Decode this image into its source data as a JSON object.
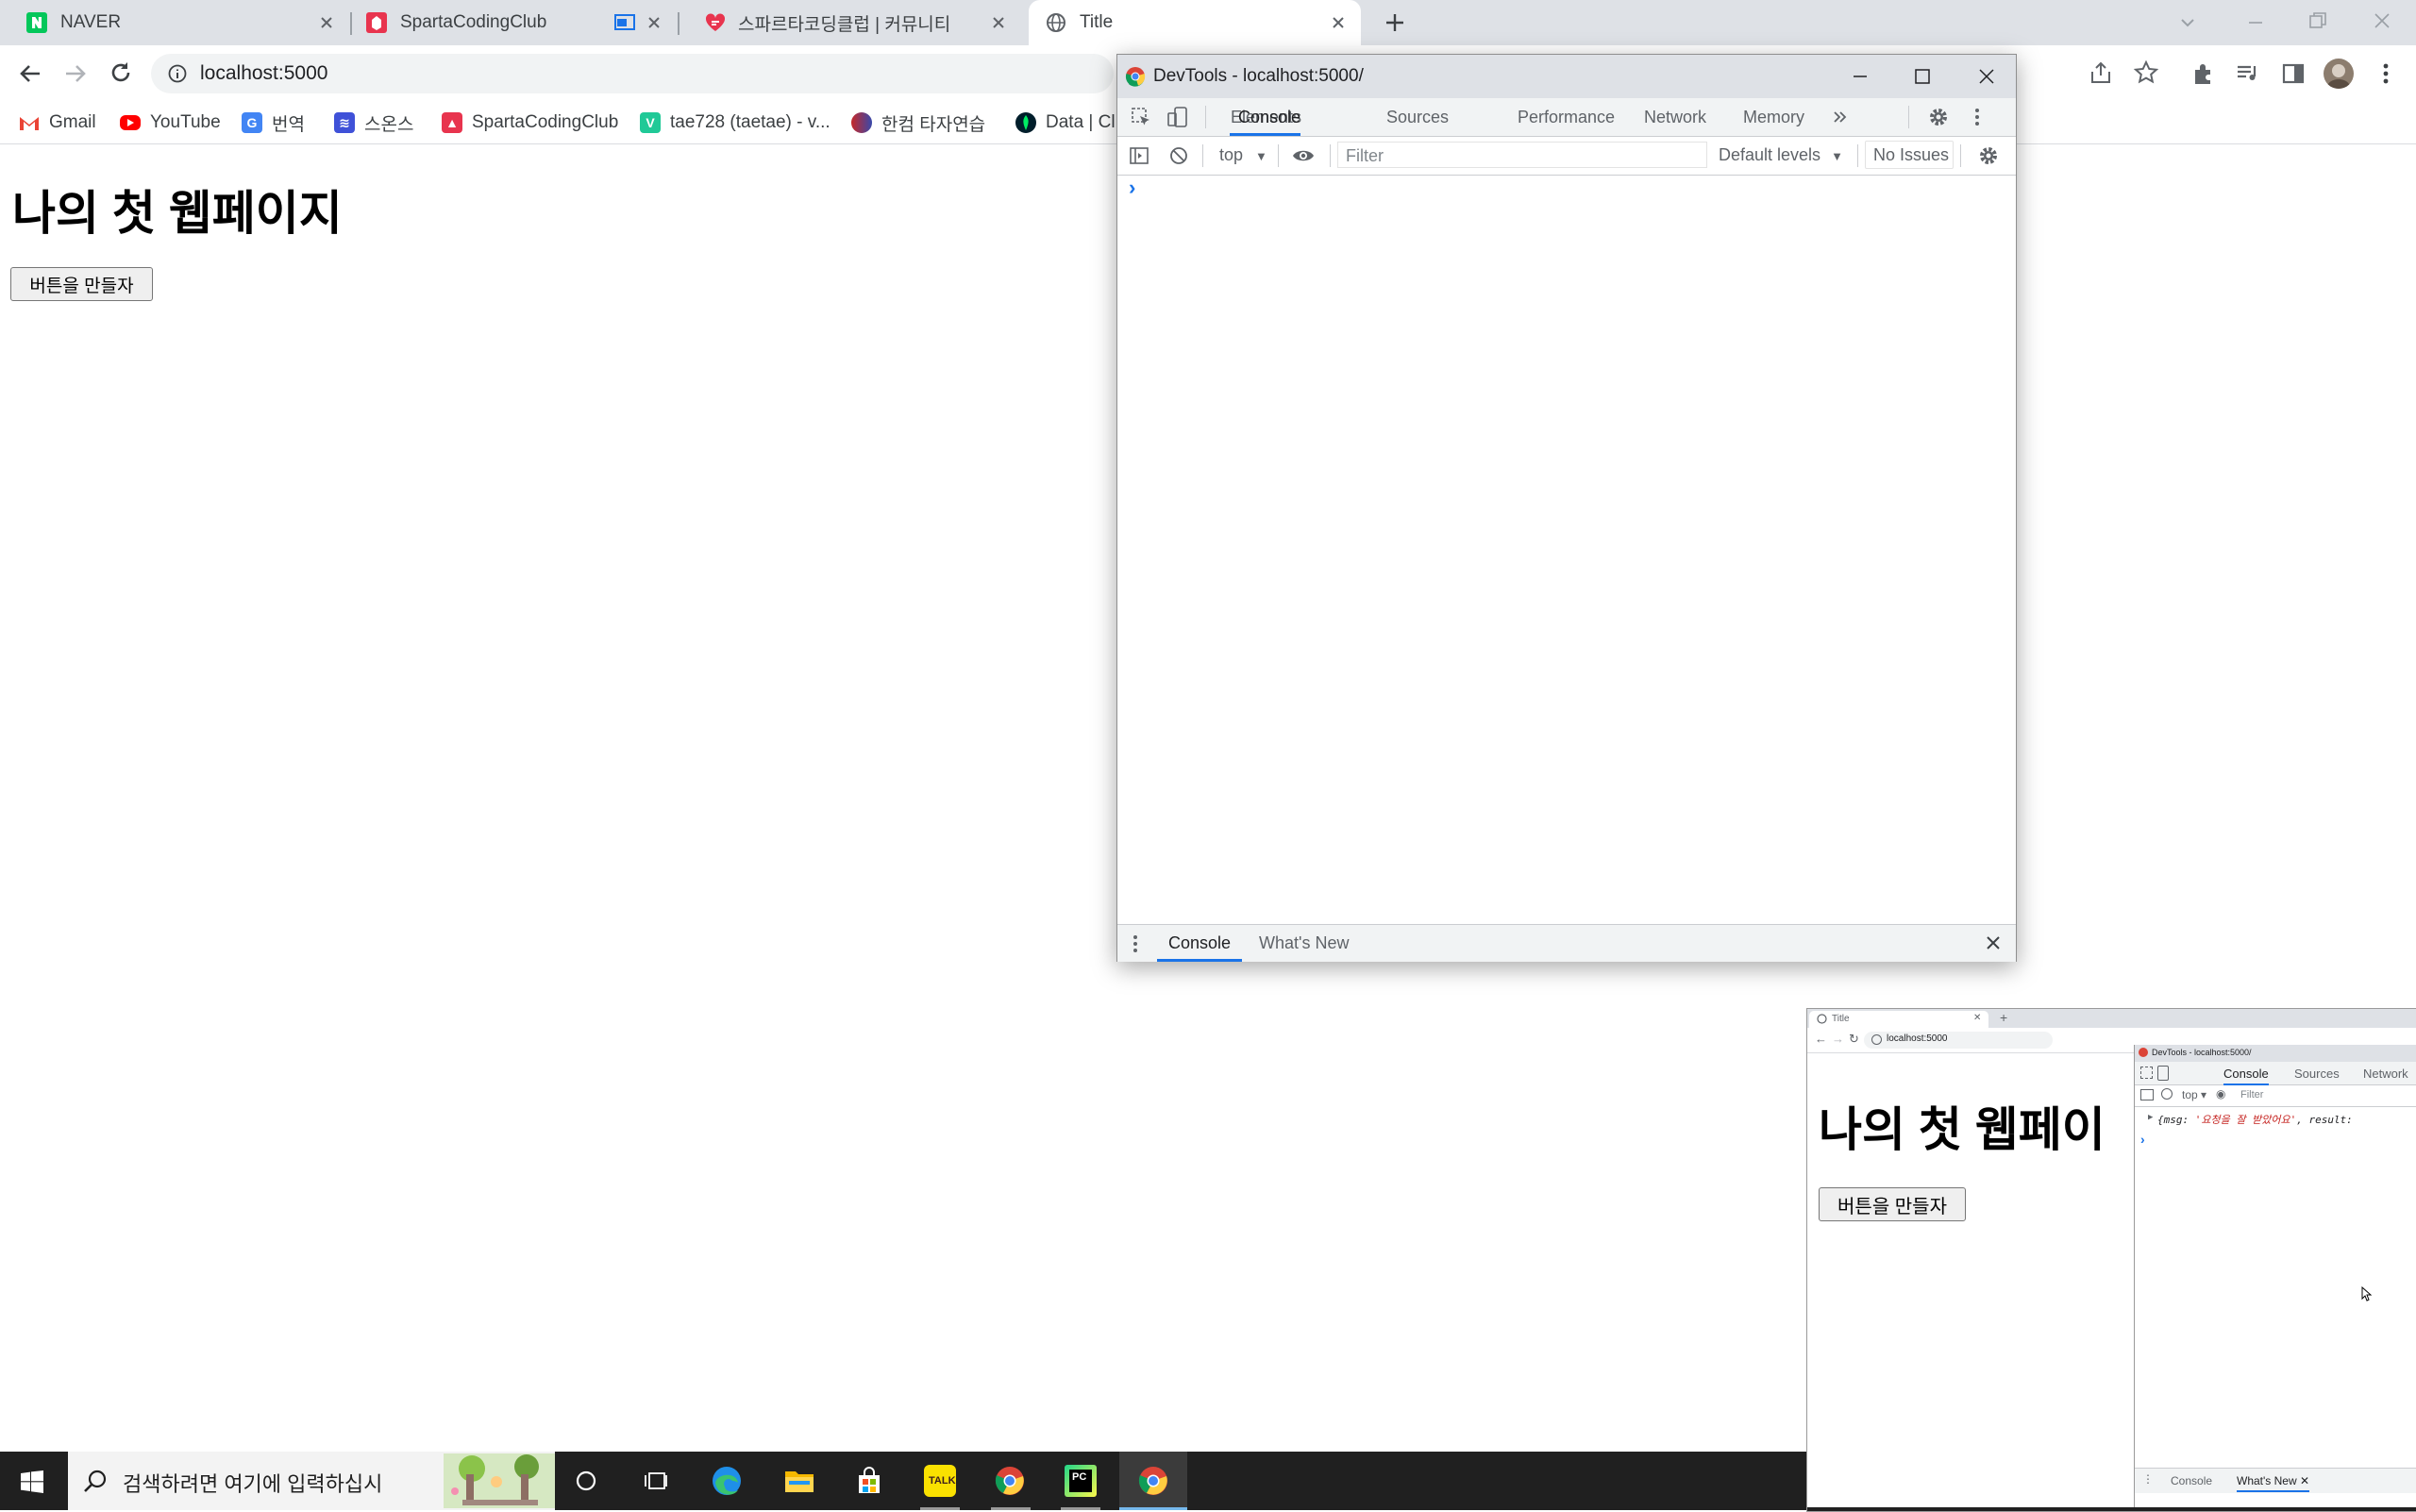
{
  "browser": {
    "tabs": [
      {
        "title": "NAVER",
        "favicon": "naver-icon"
      },
      {
        "title": "SpartaCodingClub",
        "favicon": "sparta-icon"
      },
      {
        "title": "스파르타코딩클럽 | 커뮤니티",
        "favicon": "sparta-community-icon"
      },
      {
        "title": "Title",
        "favicon": "globe-icon",
        "active": true
      }
    ],
    "url": "localhost:5000",
    "bookmarks": [
      {
        "label": "Gmail",
        "icon": "gmail-icon"
      },
      {
        "label": "YouTube",
        "icon": "youtube-icon"
      },
      {
        "label": "번역",
        "icon": "translate-icon"
      },
      {
        "label": "스온스",
        "icon": "bookmark-icon"
      },
      {
        "label": "SpartaCodingClub",
        "icon": "sparta-icon"
      },
      {
        "label": "tae728 (taetae) - v...",
        "icon": "velog-icon"
      },
      {
        "label": "한컴 타자연습",
        "icon": "hancom-icon"
      },
      {
        "label": "Data | Cl",
        "icon": "mongodb-icon"
      }
    ]
  },
  "page": {
    "heading": "나의 첫 웹페이지",
    "button_label": "버튼을 만들자"
  },
  "devtools": {
    "window_title": "DevTools - localhost:5000/",
    "tabs": [
      "Elements",
      "Console",
      "Sources",
      "Performance",
      "Network",
      "Memory"
    ],
    "selected_tab": "Console",
    "context": "top",
    "filter_placeholder": "Filter",
    "levels": "Default levels",
    "issues": "No Issues",
    "prompt": "›",
    "drawer_tabs": [
      "Console",
      "What's New"
    ]
  },
  "thumbnail": {
    "tab_title": "Title",
    "url": "localhost:5000",
    "heading": "나의 첫 웹페이",
    "button_label": "버튼을 만들자",
    "devtools_title": "DevTools - localhost:5000/",
    "devtools_tabs": [
      "Console",
      "Sources",
      "Network"
    ],
    "context": "top",
    "filter_placeholder": "Filter",
    "log_prefix": "{msg: ",
    "log_msg": "'요청을 잘 받았어요'",
    "log_suffix": ", result:",
    "drawer_tabs": [
      "Console",
      "What's New"
    ]
  },
  "taskbar": {
    "search_placeholder": "검색하려면 여기에 입력하십시",
    "apps": [
      "cortana-icon",
      "task-view-icon",
      "edge-icon",
      "file-explorer-icon",
      "store-icon",
      "kakaotalk-icon",
      "chrome-icon",
      "pycharm-icon",
      "chrome-icon"
    ],
    "kakao_label": "TALK",
    "pycharm_label": "PC"
  },
  "colors": {
    "tabstrip": "#dee1e6",
    "accent": "#1a73e8",
    "taskbar": "#202020",
    "naver": "#03c75a",
    "youtube": "#ff0000",
    "sparta": "#e8344e"
  }
}
